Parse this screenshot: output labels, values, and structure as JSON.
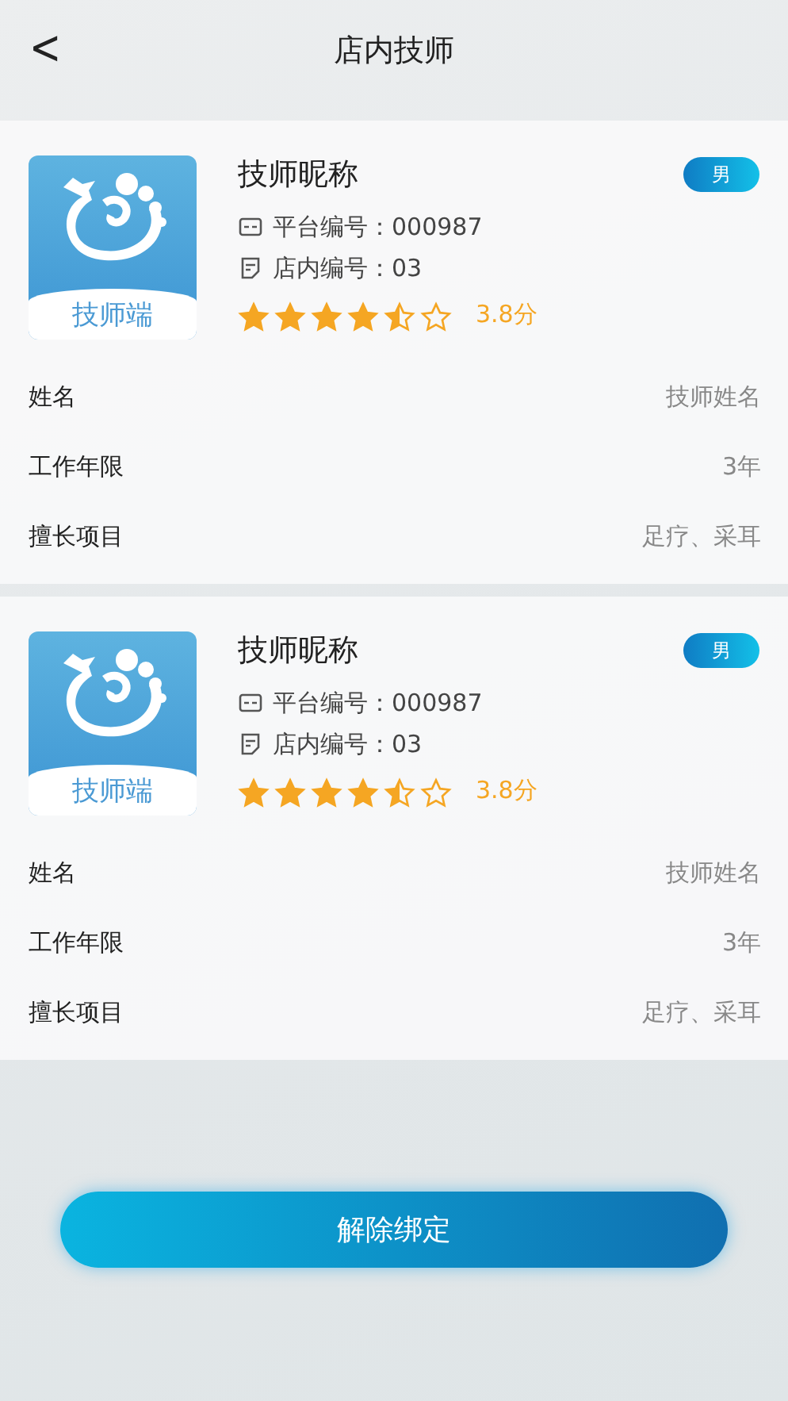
{
  "header": {
    "back": "<",
    "title": "店内技师"
  },
  "technicians": [
    {
      "logo_text": "技师端",
      "nickname": "技师昵称",
      "gender": "男",
      "platform_id": "平台编号：000987",
      "store_id": "店内编号：03",
      "stars": 4.5,
      "score": "3.8分",
      "fields": [
        {
          "label": "姓名",
          "value": "技师姓名"
        },
        {
          "label": "工作年限",
          "value": "3年"
        },
        {
          "label": "擅长项目",
          "value": "足疗、采耳"
        }
      ]
    },
    {
      "logo_text": "技师端",
      "nickname": "技师昵称",
      "gender": "男",
      "platform_id": "平台编号：000987",
      "store_id": "店内编号：03",
      "stars": 4.5,
      "score": "3.8分",
      "fields": [
        {
          "label": "姓名",
          "value": "技师姓名"
        },
        {
          "label": "工作年限",
          "value": "3年"
        },
        {
          "label": "擅长项目",
          "value": "足疗、采耳"
        }
      ]
    }
  ],
  "button": "解除绑定"
}
